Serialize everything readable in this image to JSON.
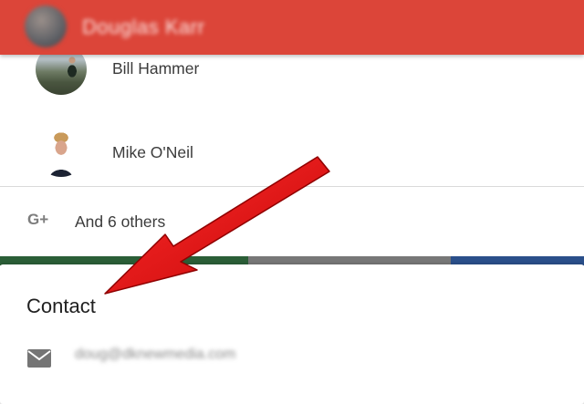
{
  "header": {
    "name": "Douglas Karr",
    "background_color": "#dc4539"
  },
  "people": [
    {
      "name": "Bill Hammer"
    },
    {
      "name": "Mike O'Neil"
    }
  ],
  "others": {
    "icon": "google-plus-icon",
    "label": "And 6 others"
  },
  "stripe_colors": [
    "#2b5e37",
    "#777777",
    "#2a4f8a"
  ],
  "contact": {
    "heading": "Contact",
    "email_icon": "mail-icon",
    "email": "doug@dknewmedia.com"
  },
  "annotation": {
    "arrow_color": "#e60f0f"
  }
}
